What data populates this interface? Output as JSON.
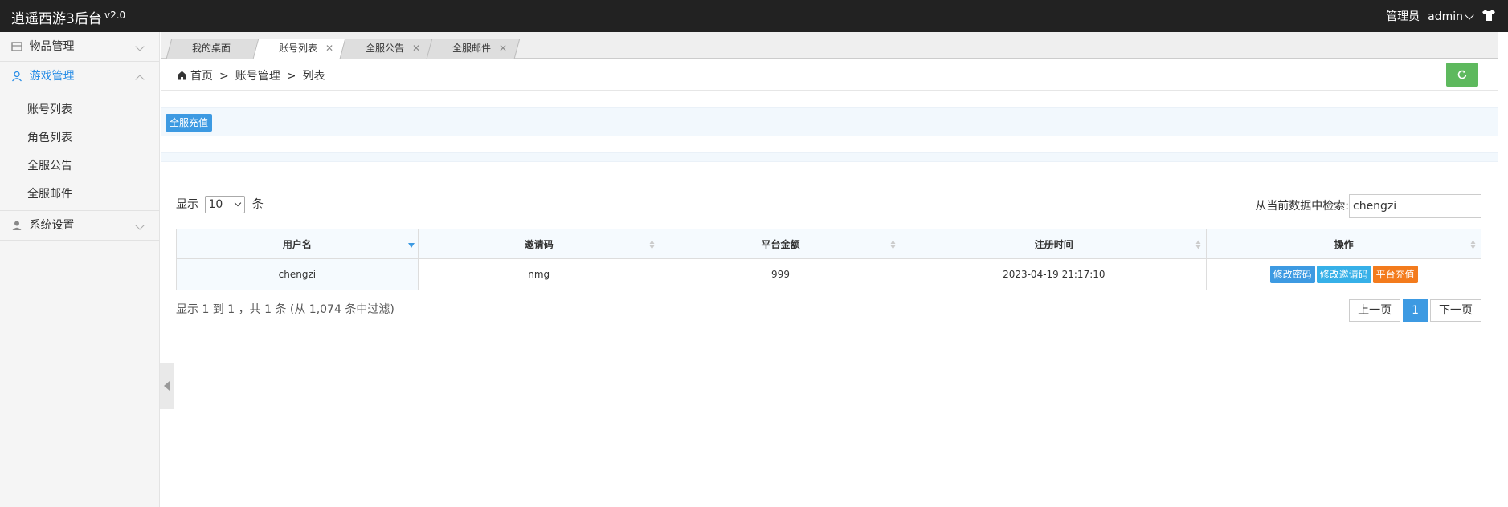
{
  "header": {
    "title": "逍遥西游3后台",
    "version": "v2.0",
    "role": "管理员",
    "username": "admin"
  },
  "sidebar": {
    "items": [
      {
        "label": "物品管理",
        "icon": "box-icon"
      },
      {
        "label": "游戏管理",
        "icon": "user-icon",
        "active": true
      },
      {
        "label": "系统设置",
        "icon": "person-icon"
      }
    ],
    "submenu": [
      "账号列表",
      "角色列表",
      "全服公告",
      "全服邮件"
    ]
  },
  "tabs": [
    {
      "label": "我的桌面",
      "closable": false
    },
    {
      "label": "账号列表",
      "closable": true,
      "active": true
    },
    {
      "label": "全服公告",
      "closable": true
    },
    {
      "label": "全服邮件",
      "closable": true
    }
  ],
  "breadcrumb": {
    "home": "首页",
    "sep": ">",
    "level1": "账号管理",
    "level2": "列表"
  },
  "actions": {
    "recharge_all": "全服充值"
  },
  "table_controls": {
    "show_prefix": "显示",
    "page_size": "10",
    "show_suffix": "条",
    "search_label": "从当前数据中检索:",
    "search_value": "chengzi"
  },
  "table": {
    "headers": [
      "用户名",
      "邀请码",
      "平台金额",
      "注册时间",
      "操作"
    ],
    "rows": [
      {
        "username": "chengzi",
        "invite_code": "nmg",
        "balance": "999",
        "registered": "2023-04-19 21:17:10",
        "ops": [
          "修改密码",
          "修改邀请码",
          "平台充值"
        ]
      }
    ]
  },
  "footer": {
    "info": "显示 1 到 1 ，共 1 条 (从 1,074 条中过滤)",
    "prev": "上一页",
    "current": "1",
    "next": "下一页"
  },
  "colors": {
    "accent": "#3d9ae2",
    "success": "#5eb95e",
    "warning": "#f37b1d",
    "topbar": "#222222"
  }
}
